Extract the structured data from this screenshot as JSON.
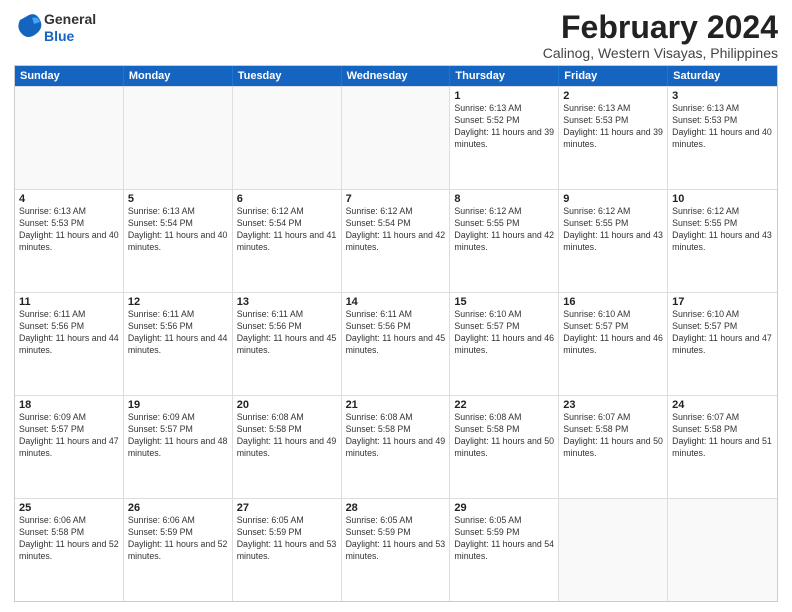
{
  "app": {
    "logo_general": "General",
    "logo_blue": "Blue",
    "title": "February 2024",
    "subtitle": "Calinog, Western Visayas, Philippines"
  },
  "header_days": [
    "Sunday",
    "Monday",
    "Tuesday",
    "Wednesday",
    "Thursday",
    "Friday",
    "Saturday"
  ],
  "rows": [
    [
      {
        "day": "",
        "empty": true
      },
      {
        "day": "",
        "empty": true
      },
      {
        "day": "",
        "empty": true
      },
      {
        "day": "",
        "empty": true
      },
      {
        "day": "1",
        "sunrise": "6:13 AM",
        "sunset": "5:52 PM",
        "daylight": "11 hours and 39 minutes."
      },
      {
        "day": "2",
        "sunrise": "6:13 AM",
        "sunset": "5:53 PM",
        "daylight": "11 hours and 39 minutes."
      },
      {
        "day": "3",
        "sunrise": "6:13 AM",
        "sunset": "5:53 PM",
        "daylight": "11 hours and 40 minutes."
      }
    ],
    [
      {
        "day": "4",
        "sunrise": "6:13 AM",
        "sunset": "5:53 PM",
        "daylight": "11 hours and 40 minutes."
      },
      {
        "day": "5",
        "sunrise": "6:13 AM",
        "sunset": "5:54 PM",
        "daylight": "11 hours and 40 minutes."
      },
      {
        "day": "6",
        "sunrise": "6:12 AM",
        "sunset": "5:54 PM",
        "daylight": "11 hours and 41 minutes."
      },
      {
        "day": "7",
        "sunrise": "6:12 AM",
        "sunset": "5:54 PM",
        "daylight": "11 hours and 42 minutes."
      },
      {
        "day": "8",
        "sunrise": "6:12 AM",
        "sunset": "5:55 PM",
        "daylight": "11 hours and 42 minutes."
      },
      {
        "day": "9",
        "sunrise": "6:12 AM",
        "sunset": "5:55 PM",
        "daylight": "11 hours and 43 minutes."
      },
      {
        "day": "10",
        "sunrise": "6:12 AM",
        "sunset": "5:55 PM",
        "daylight": "11 hours and 43 minutes."
      }
    ],
    [
      {
        "day": "11",
        "sunrise": "6:11 AM",
        "sunset": "5:56 PM",
        "daylight": "11 hours and 44 minutes."
      },
      {
        "day": "12",
        "sunrise": "6:11 AM",
        "sunset": "5:56 PM",
        "daylight": "11 hours and 44 minutes."
      },
      {
        "day": "13",
        "sunrise": "6:11 AM",
        "sunset": "5:56 PM",
        "daylight": "11 hours and 45 minutes."
      },
      {
        "day": "14",
        "sunrise": "6:11 AM",
        "sunset": "5:56 PM",
        "daylight": "11 hours and 45 minutes."
      },
      {
        "day": "15",
        "sunrise": "6:10 AM",
        "sunset": "5:57 PM",
        "daylight": "11 hours and 46 minutes."
      },
      {
        "day": "16",
        "sunrise": "6:10 AM",
        "sunset": "5:57 PM",
        "daylight": "11 hours and 46 minutes."
      },
      {
        "day": "17",
        "sunrise": "6:10 AM",
        "sunset": "5:57 PM",
        "daylight": "11 hours and 47 minutes."
      }
    ],
    [
      {
        "day": "18",
        "sunrise": "6:09 AM",
        "sunset": "5:57 PM",
        "daylight": "11 hours and 47 minutes."
      },
      {
        "day": "19",
        "sunrise": "6:09 AM",
        "sunset": "5:57 PM",
        "daylight": "11 hours and 48 minutes."
      },
      {
        "day": "20",
        "sunrise": "6:08 AM",
        "sunset": "5:58 PM",
        "daylight": "11 hours and 49 minutes."
      },
      {
        "day": "21",
        "sunrise": "6:08 AM",
        "sunset": "5:58 PM",
        "daylight": "11 hours and 49 minutes."
      },
      {
        "day": "22",
        "sunrise": "6:08 AM",
        "sunset": "5:58 PM",
        "daylight": "11 hours and 50 minutes."
      },
      {
        "day": "23",
        "sunrise": "6:07 AM",
        "sunset": "5:58 PM",
        "daylight": "11 hours and 50 minutes."
      },
      {
        "day": "24",
        "sunrise": "6:07 AM",
        "sunset": "5:58 PM",
        "daylight": "11 hours and 51 minutes."
      }
    ],
    [
      {
        "day": "25",
        "sunrise": "6:06 AM",
        "sunset": "5:58 PM",
        "daylight": "11 hours and 52 minutes."
      },
      {
        "day": "26",
        "sunrise": "6:06 AM",
        "sunset": "5:59 PM",
        "daylight": "11 hours and 52 minutes."
      },
      {
        "day": "27",
        "sunrise": "6:05 AM",
        "sunset": "5:59 PM",
        "daylight": "11 hours and 53 minutes."
      },
      {
        "day": "28",
        "sunrise": "6:05 AM",
        "sunset": "5:59 PM",
        "daylight": "11 hours and 53 minutes."
      },
      {
        "day": "29",
        "sunrise": "6:05 AM",
        "sunset": "5:59 PM",
        "daylight": "11 hours and 54 minutes."
      },
      {
        "day": "",
        "empty": true
      },
      {
        "day": "",
        "empty": true
      }
    ]
  ]
}
